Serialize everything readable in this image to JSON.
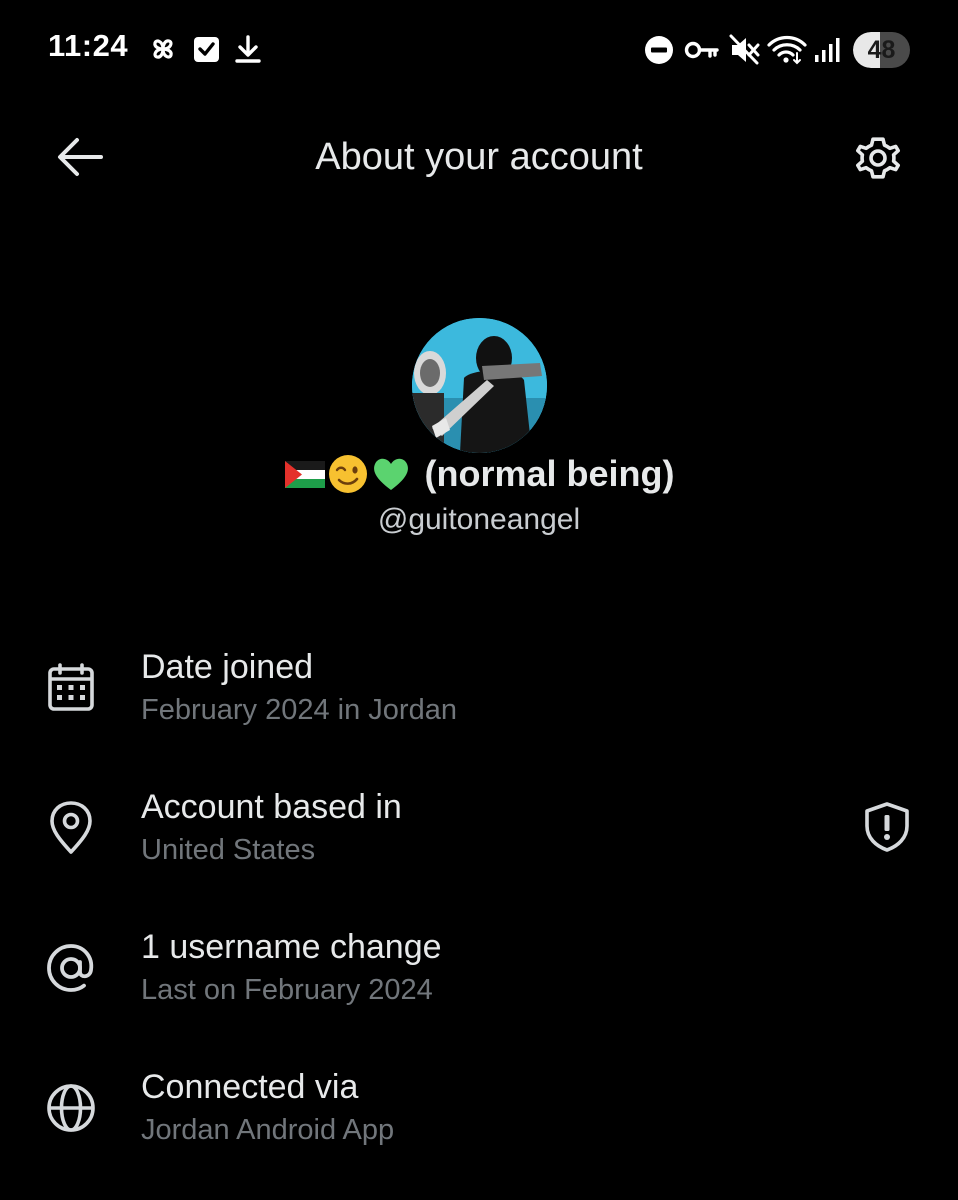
{
  "status_bar": {
    "time": "11:24",
    "battery_percent": 48,
    "battery_label": "48",
    "left_icons": [
      "pinwheel-icon",
      "checkbox-icon",
      "download-icon"
    ],
    "right_icons": [
      "do-not-disturb-icon",
      "vpn-key-icon",
      "muted-icon",
      "wifi-icon",
      "cell-signal-icon"
    ]
  },
  "header": {
    "title": "About your account",
    "back_icon": "arrow-left-icon",
    "settings_icon": "gear-icon"
  },
  "profile": {
    "display_name": "(normal being)",
    "name_emojis": [
      "palestine-flag",
      "winking-face",
      "green-heart"
    ],
    "handle": "@guitoneangel"
  },
  "details": [
    {
      "icon": "calendar-icon",
      "title": "Date joined",
      "subtitle": "February 2024 in Jordan"
    },
    {
      "icon": "location-pin-icon",
      "title": "Account based in",
      "subtitle": "United States",
      "trailing_icon": "shield-alert-icon"
    },
    {
      "icon": "at-sign-icon",
      "title": "1 username change",
      "subtitle": "Last on February 2024"
    },
    {
      "icon": "globe-icon",
      "title": "Connected via",
      "subtitle": "Jordan Android App"
    }
  ],
  "colors": {
    "background": "#000000",
    "primary_text": "#e7e9ea",
    "secondary_text": "#71767b",
    "icon": "#d6d9dc"
  }
}
